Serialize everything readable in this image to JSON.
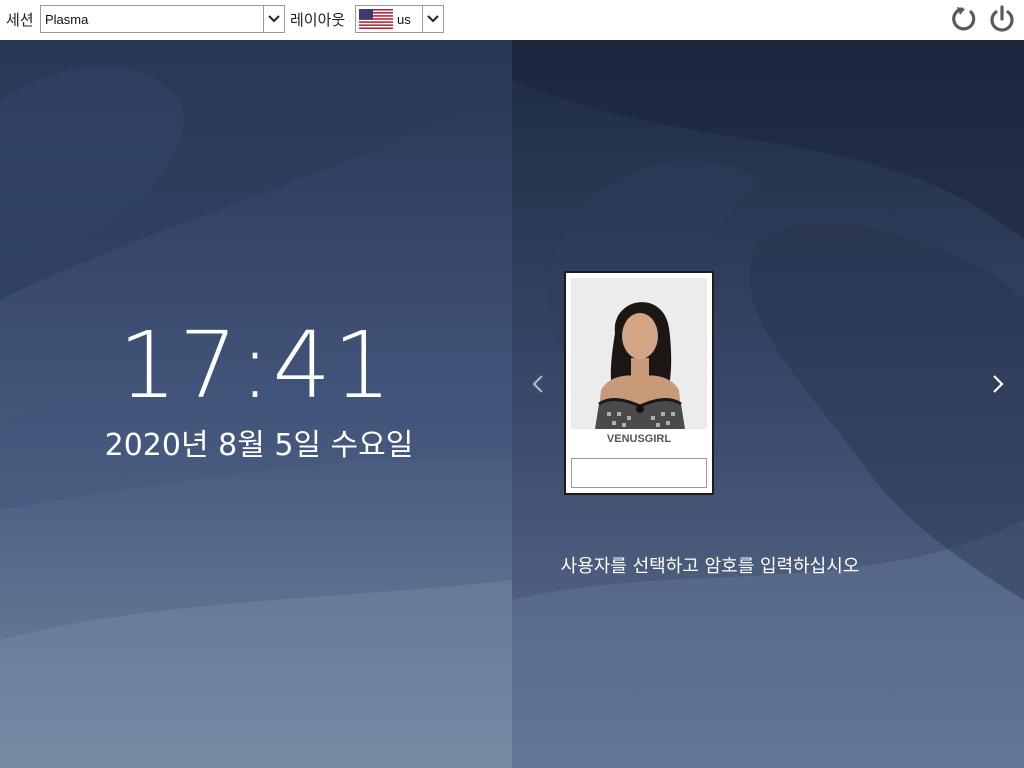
{
  "topbar": {
    "session_label": "세션",
    "session_value": "Plasma",
    "layout_label": "레이아웃",
    "layout_value": "us",
    "layout_flag_icon": "us-flag-icon",
    "reboot_icon": "reboot-icon",
    "power_icon": "power-icon"
  },
  "clock": {
    "time": "17:41",
    "date": "2020년 8월 5일 수요일"
  },
  "user_card": {
    "username": "VENUSGIRL",
    "password_value": ""
  },
  "prompt": "사용자를 선택하고 암호를 입력하십시오",
  "colors": {
    "bg_top": "#1f2a40",
    "bg_bottom": "#6c7f9d",
    "bar": "#ffffff",
    "icon_gray": "#555555"
  }
}
